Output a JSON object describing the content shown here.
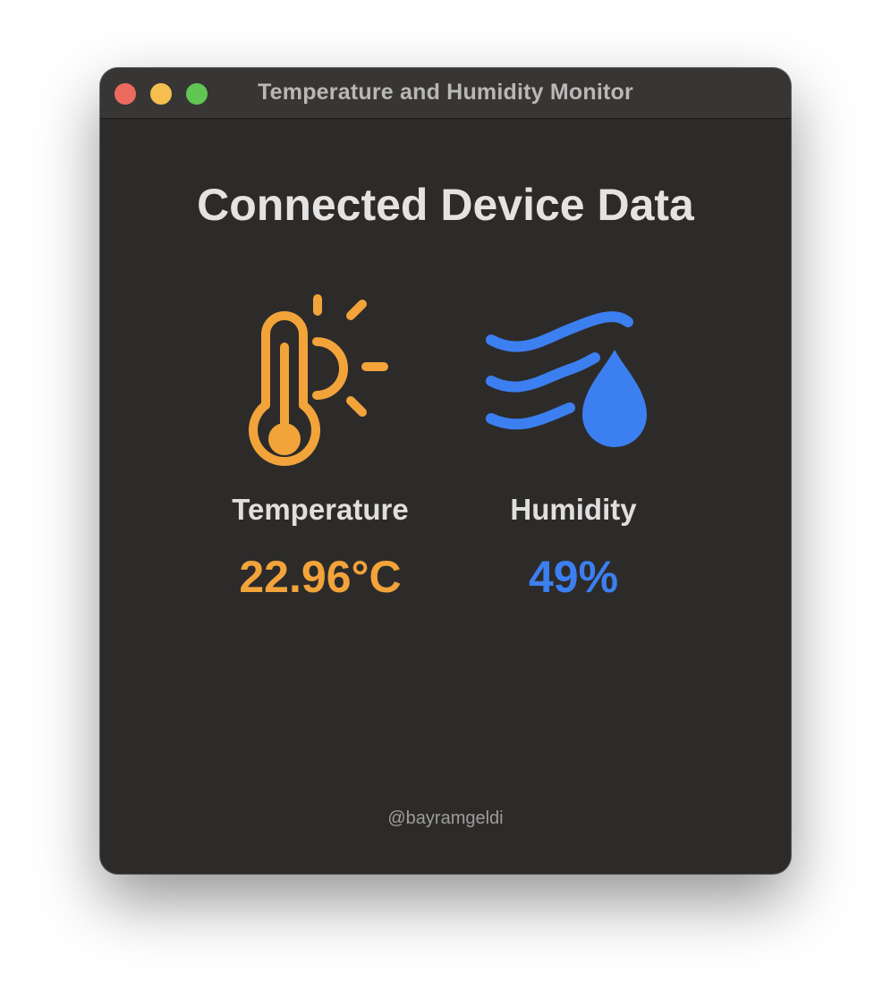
{
  "window": {
    "title": "Temperature and Humidity Monitor"
  },
  "main": {
    "heading": "Connected Device Data",
    "temperature": {
      "label": "Temperature",
      "value": "22.96°C",
      "icon": "thermometer-sun-icon",
      "color": "#f2a33a"
    },
    "humidity": {
      "label": "Humidity",
      "value": "49%",
      "icon": "humidity-icon",
      "color": "#3c7ff1"
    },
    "footer": "@bayramgeldi"
  },
  "colors": {
    "background": "#2c2b2a",
    "titlebar": "#373635",
    "close": "#ed6a5e",
    "minimize": "#f5bf4f",
    "maximize": "#61c554"
  }
}
